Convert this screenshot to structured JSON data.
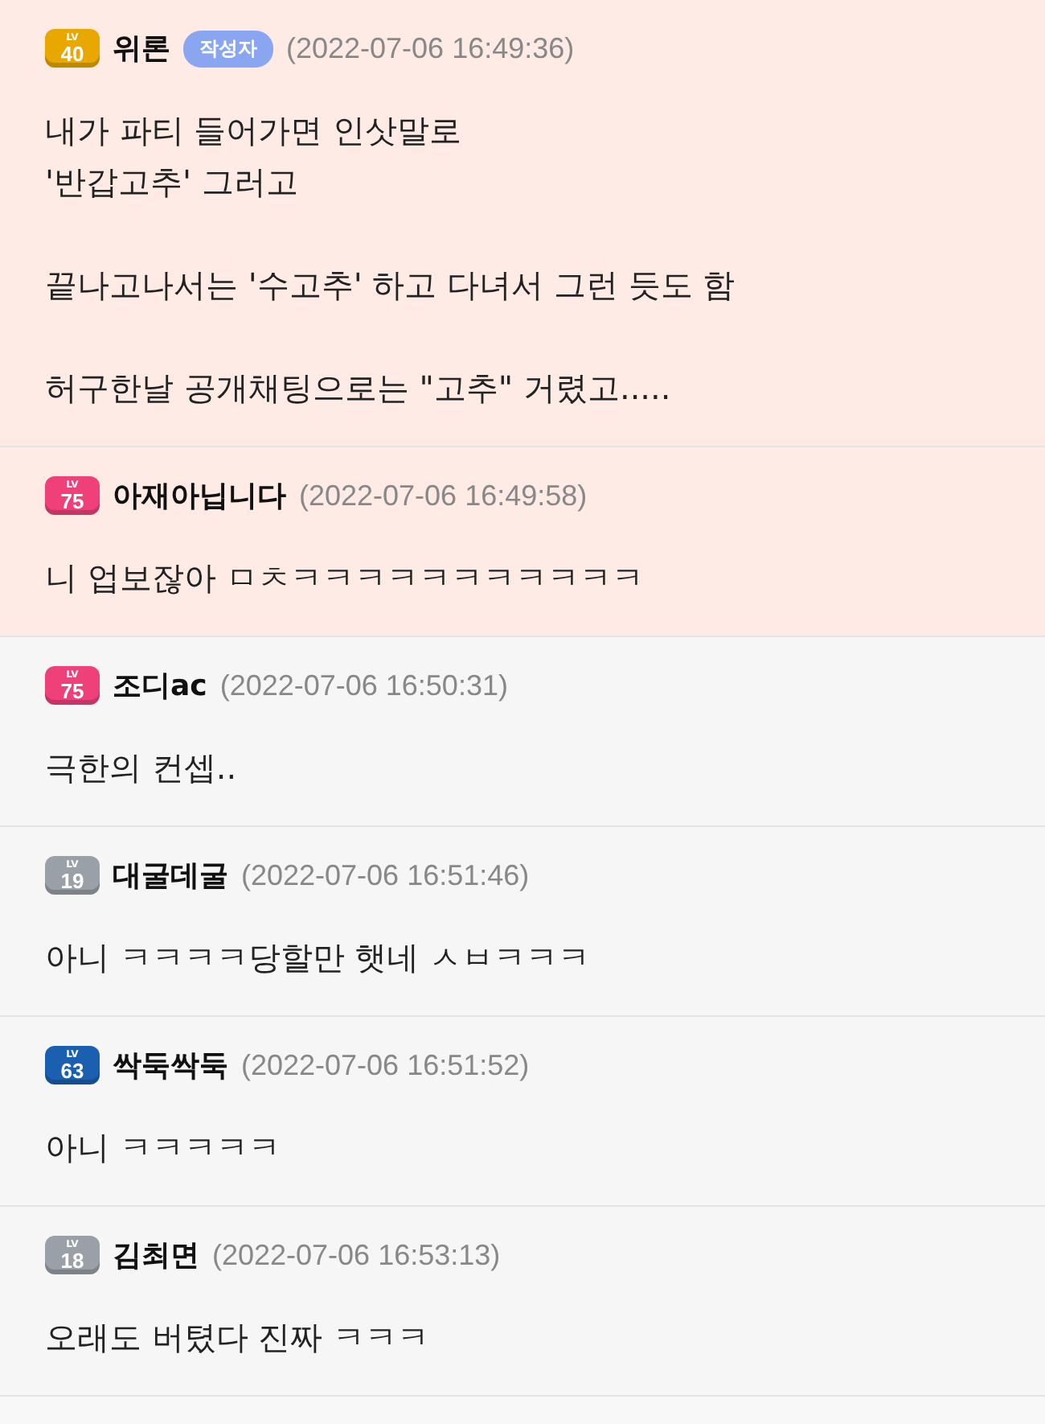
{
  "comments": [
    {
      "badge_label": "LV",
      "rank": "40",
      "color": "#e8a800",
      "author": "위론",
      "author_tag": "작성자",
      "time": "(2022-07-06 16:49:36)",
      "highlighted": true,
      "paragraphs": [
        "내가 파티 들어가면 인삿말로\n'반갑고추' 그러고",
        "끝나고나서는 '수고추' 하고 다녀서 그런 듯도 함",
        "허구한날 공개채팅으로는 \"고추\" 거렸고....."
      ]
    },
    {
      "badge_label": "LV",
      "rank": "75",
      "color": "#f0407a",
      "author": "아재아닙니다",
      "time": "(2022-07-06 16:49:58)",
      "highlighted": true,
      "paragraphs": [
        "니 업보잖아 ㅁㅊㅋㅋㅋㅋㅋㅋㅋㅋㅋㅋㅋ"
      ]
    },
    {
      "badge_label": "LV",
      "rank": "75",
      "color": "#f0407a",
      "author": "조디ac",
      "time": "(2022-07-06 16:50:31)",
      "highlighted": false,
      "paragraphs": [
        "극한의 컨셉.."
      ]
    },
    {
      "badge_label": "LV",
      "rank": "19",
      "color": "#9aa0a8",
      "author": "대굴데굴",
      "time": "(2022-07-06 16:51:46)",
      "highlighted": false,
      "paragraphs": [
        "아니 ㅋㅋㅋㅋ당할만 햇네 ㅅㅂㅋㅋㅋ"
      ]
    },
    {
      "badge_label": "LV",
      "rank": "63",
      "color": "#1a5fb0",
      "author": "싹둑싹둑",
      "time": "(2022-07-06 16:51:52)",
      "highlighted": false,
      "paragraphs": [
        "아니 ㅋㅋㅋㅋㅋ"
      ]
    },
    {
      "badge_label": "LV",
      "rank": "18",
      "color": "#9aa0a8",
      "author": "김최면",
      "time": "(2022-07-06 16:53:13)",
      "highlighted": false,
      "paragraphs": [
        "오래도 버텼다 진짜 ㅋㅋㅋ"
      ]
    }
  ]
}
